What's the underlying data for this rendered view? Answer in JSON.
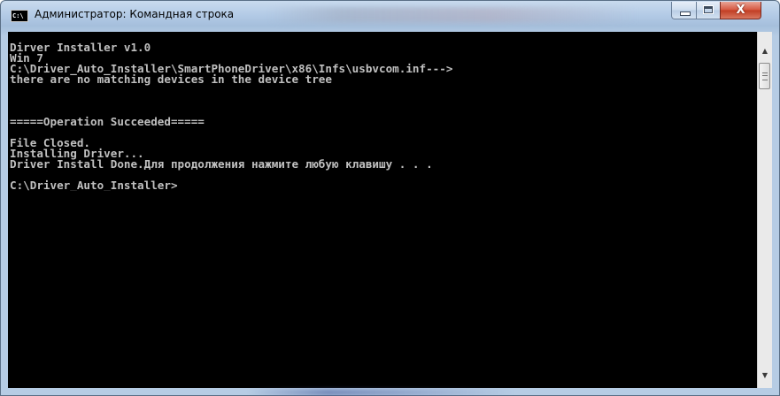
{
  "window": {
    "title": "Администратор: Командная строка",
    "icon_text": "C:\\",
    "icon": "cmd-icon"
  },
  "controls": {
    "minimize": "minimize-icon",
    "maximize": "maximize-icon",
    "close": "close-icon",
    "close_glyph": "X"
  },
  "console": {
    "text": "Dirver Installer v1.0\nWin 7\nC:\\Driver_Auto_Installer\\SmartPhoneDriver\\x86\\Infs\\usbvcom.inf--->\nthere are no matching devices in the device tree\n\n\n\n=====Operation Succeeded=====\n\nFile Closed.\nInstalling Driver...\nDriver Install Done.Для продолжения нажмите любую клавишу . . .\n\nC:\\Driver_Auto_Installer>",
    "foreground": "#c0c0c0",
    "background": "#000000"
  },
  "scrollbar": {
    "up_glyph": "▲",
    "down_glyph": "▼"
  },
  "colors": {
    "close_button": "#c8462c",
    "frame": "#b3cbe6"
  }
}
